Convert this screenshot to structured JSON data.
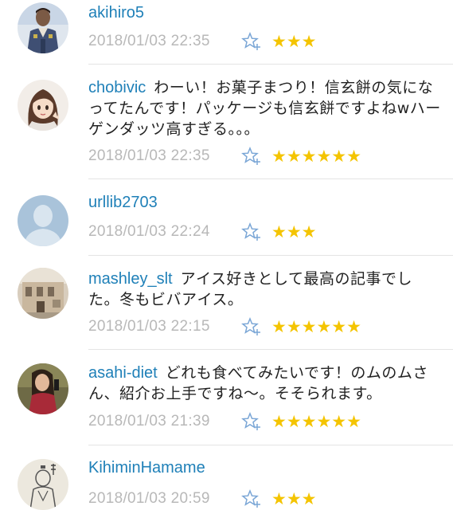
{
  "comments": [
    {
      "username": "akihiro5",
      "text": "",
      "timestamp": "2018/01/03 22:35",
      "rating": "★★★",
      "avatar": "man-in-uniform-avatar"
    },
    {
      "username": "chobivic",
      "text": "わーい！お菓子まつり！信玄餅の気になってたんです！パッケージも信玄餅ですよねwハーゲンダッツ高すぎる。。。",
      "timestamp": "2018/01/03 22:35",
      "rating": "★★★★★★",
      "avatar": "anime-girl-avatar"
    },
    {
      "username": "urllib2703",
      "text": "",
      "timestamp": "2018/01/03 22:24",
      "rating": "★★★",
      "avatar": "default-user-avatar"
    },
    {
      "username": "mashley_slt",
      "text": "アイス好きとして最高の記事でした。冬もビバアイス。",
      "timestamp": "2018/01/03 22:15",
      "rating": "★★★★★★",
      "avatar": "building-photo-avatar"
    },
    {
      "username": "asahi-diet",
      "text": "どれも食べてみたいです！のムのムさん、紹介お上手ですね〜。そそられます。",
      "timestamp": "2018/01/03 21:39",
      "rating": "★★★★★★",
      "avatar": "woman-photo-avatar"
    },
    {
      "username": "KihiminHamame",
      "text": "",
      "timestamp": "2018/01/03 20:59",
      "rating": "★★★",
      "avatar": "sketch-figure-avatar"
    }
  ],
  "colors": {
    "username": "#1f80b8",
    "timestamp": "#b8b8b8",
    "star": "#f4c400",
    "fav_icon": "#7aa6d6"
  }
}
